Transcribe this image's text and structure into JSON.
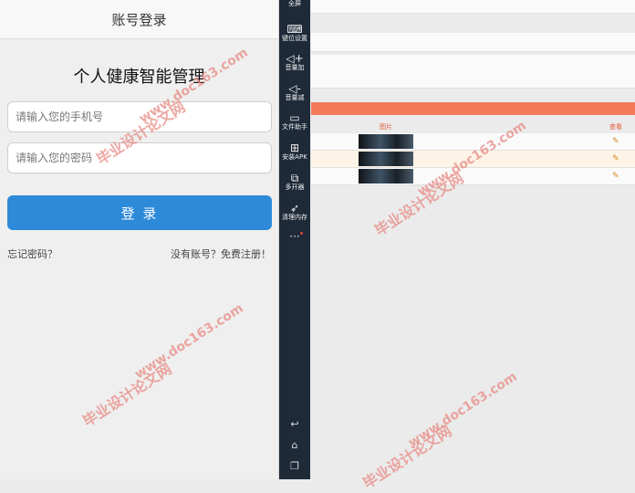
{
  "login": {
    "header_title": "账号登录",
    "app_title": "个人健康智能管理",
    "phone_placeholder": "请输入您的手机号",
    "password_placeholder": "请输入您的密码",
    "login_button": "登 录",
    "forgot_link": "忘记密码？",
    "register_link": "没有账号？免费注册！"
  },
  "toolbar": {
    "items": [
      {
        "label": "全屏",
        "icon": "fullscreen-icon"
      },
      {
        "label": "键位设置",
        "icon": "keyboard-icon"
      },
      {
        "label": "音量加",
        "icon": "volume-up-icon"
      },
      {
        "label": "音量减",
        "icon": "volume-down-icon"
      },
      {
        "label": "文件助手",
        "icon": "file-monitor-icon"
      },
      {
        "label": "安装APK",
        "icon": "install-apk-icon"
      },
      {
        "label": "多开器",
        "icon": "multi-instance-icon"
      },
      {
        "label": "清理内存",
        "icon": "rocket-icon"
      }
    ],
    "more": "···"
  },
  "web": {
    "table_header_image": "图片",
    "table_header_view": "查看",
    "row_count": 3,
    "accent_color": "#f47a5a"
  },
  "watermarks": [
    {
      "cn": "毕业设计论文网",
      "url": "www.doc163.com"
    }
  ]
}
